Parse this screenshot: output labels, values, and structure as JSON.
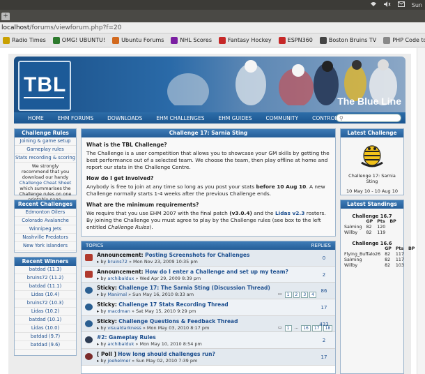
{
  "browser": {
    "os_right": "Sun",
    "address_host": "localhost",
    "address_path": "/forums/viewforum.php?f=20",
    "bookmarks": [
      {
        "label": "Radio Times",
        "icon": "rt-icon",
        "color": "#c9a000"
      },
      {
        "label": "OMG! UBUNTU!",
        "icon": "omg-icon",
        "color": "#2d7a2d"
      },
      {
        "label": "Ubuntu Forums",
        "icon": "ubuntu-icon",
        "color": "#d2691e"
      },
      {
        "label": "NHL Scores",
        "icon": "yahoo-icon",
        "color": "#7b1fa2"
      },
      {
        "label": "Fantasy Hockey",
        "icon": "fantasy-icon",
        "color": "#c62828"
      },
      {
        "label": "ESPN360",
        "icon": "espn-icon",
        "color": "#c62828"
      },
      {
        "label": "Boston Bruins TV",
        "icon": "bruins-icon",
        "color": "#444444"
      },
      {
        "label": "PHP Code to D...",
        "icon": "page-icon",
        "color": "#888888"
      }
    ]
  },
  "header": {
    "logo_text": "TBL",
    "tagline": "The Blue Line",
    "nav": [
      "HOME",
      "EHM FORUMS",
      "DOWNLOADS",
      "EHM CHALLENGES",
      "EHM GUIDES",
      "COMMUNITY",
      "CONTROL PANEL"
    ]
  },
  "left": {
    "rules": {
      "title": "Challenge Rules",
      "links": [
        "Joining & game setup",
        "Gameplay rules",
        "Stats recording & scoring"
      ],
      "note_pre": "We strongly recommend that you download our handy",
      "note_link": "Challenge Cheat Sheet",
      "note_post": "which summarises the Challenge rules on one printable page."
    },
    "recent": {
      "title": "Recent Challenges",
      "items": [
        "Edmonton Oilers",
        "Colorado Avalanche",
        "Winnipeg Jets",
        "Nashville Predators",
        "New York Islanders"
      ]
    },
    "winners": {
      "title": "Recent Winners",
      "items": [
        "batdad (11.3)",
        "bruins72 (11.2)",
        "batdad (11.1)",
        "Lidas (10.4)",
        "bruins72 (10.3)",
        "Lidas (10.2)",
        "batdad (10.1)",
        "Lidas (10.0)",
        "batdad (9.7)",
        "batdad (9.6)"
      ]
    }
  },
  "center": {
    "title": "Challenge 17: Sarnia Sting",
    "q1": "What is the TBL Challenge?",
    "a1": "The Challenge is a user competition that allows you to showcase your GM skills by getting the best performance out of a selected team. We choose the team, then play offline at home and report our stats in the Challenge Centre.",
    "q2": "How do I get involved?",
    "a2_pre": "Anybody is free to join at any time so long as you post your stats",
    "a2_bold": "before 10 Aug 10",
    "a2_post": ". A new Challenge normally starts 1-4 weeks after the previous Challenge ends.",
    "q3": "What are the minimum requirements?",
    "a3_pre": "We require that you use EHM 2007 with the final patch",
    "a3_patch": "(v3.0.4)",
    "a3_mid": "and the",
    "a3_lidas": "Lidas v2.3",
    "a3_post": "rosters. By joining the Challenge you must agree to play by the Challenge rules (see box to the left entitled",
    "a3_italic": "Challenge Rules",
    "a3_end": ")."
  },
  "topics": {
    "header_left": "TOPICS",
    "header_right": "REPLIES",
    "rows": [
      {
        "icon": "ann",
        "prefix": "Announcement:",
        "title": "Posting Screenshots for Challenges",
        "author": "bruins72",
        "date": "» Mon Nov 23, 2009 10:35 pm",
        "replies": "0",
        "pages": []
      },
      {
        "icon": "ann",
        "prefix": "Announcement:",
        "title": "How do I enter a Challenge and set up my team?",
        "author": "archibaldux",
        "date": "» Wed Apr 29, 2009 8:39 pm",
        "replies": "2",
        "pages": []
      },
      {
        "icon": "st",
        "prefix": "Sticky:",
        "title": "Challenge 17: The Sarnia Sting (Discussion Thread)",
        "author": "Manimal",
        "date": "» Sun May 16, 2010 8:33 am",
        "replies": "86",
        "pages": [
          "1",
          "2",
          "3",
          "4"
        ]
      },
      {
        "icon": "st",
        "prefix": "Sticky:",
        "title": "Challenge 17 Stats Recording Thread",
        "author": "macdman",
        "date": "» Sat May 15, 2010 9:29 pm",
        "replies": "17",
        "pages": []
      },
      {
        "icon": "st",
        "prefix": "Sticky:",
        "title": "Challenge Questions & Feedback Thread",
        "author": "visualdarkness",
        "date": "» Mon May 03, 2010 8:17 pm",
        "replies": "433",
        "pages": [
          "1",
          "...",
          "16",
          "17",
          "18"
        ]
      },
      {
        "icon": "no",
        "prefix": "",
        "title": "#2: Gameplay Rules",
        "author": "archibalduk",
        "date": "» Mon May 10, 2010 8:54 pm",
        "replies": "2",
        "pages": []
      },
      {
        "icon": "new",
        "prefix": "[ Poll ]",
        "title": "How long should challenges run?",
        "author": "joehelmer",
        "date": "» Sun May 02, 2010 7:39 pm",
        "replies": "17",
        "pages": []
      }
    ],
    "by": "by"
  },
  "right": {
    "latest": {
      "title": "Latest Challenge",
      "name": "Challenge 17: Sarnia Sting",
      "dates": "10 May 10 - 10 Aug 10"
    },
    "standings": {
      "title": "Latest Standings",
      "c1_title": "Challenge 16.7",
      "c1_headers": [
        "GP",
        "Pts",
        "BP"
      ],
      "c1_rows": [
        [
          "Salming",
          "82",
          "120",
          ""
        ],
        [
          "Willby",
          "82",
          "119",
          ""
        ]
      ],
      "c2_title": "Challenge 16.6",
      "c2_headers": [
        "GP",
        "Pts",
        "BP"
      ],
      "c2_rows": [
        [
          "Flying_Buffalo26",
          "82",
          "117",
          ""
        ],
        [
          "Salming",
          "82",
          "117",
          ""
        ],
        [
          "Willby",
          "82",
          "103",
          ""
        ]
      ]
    }
  }
}
